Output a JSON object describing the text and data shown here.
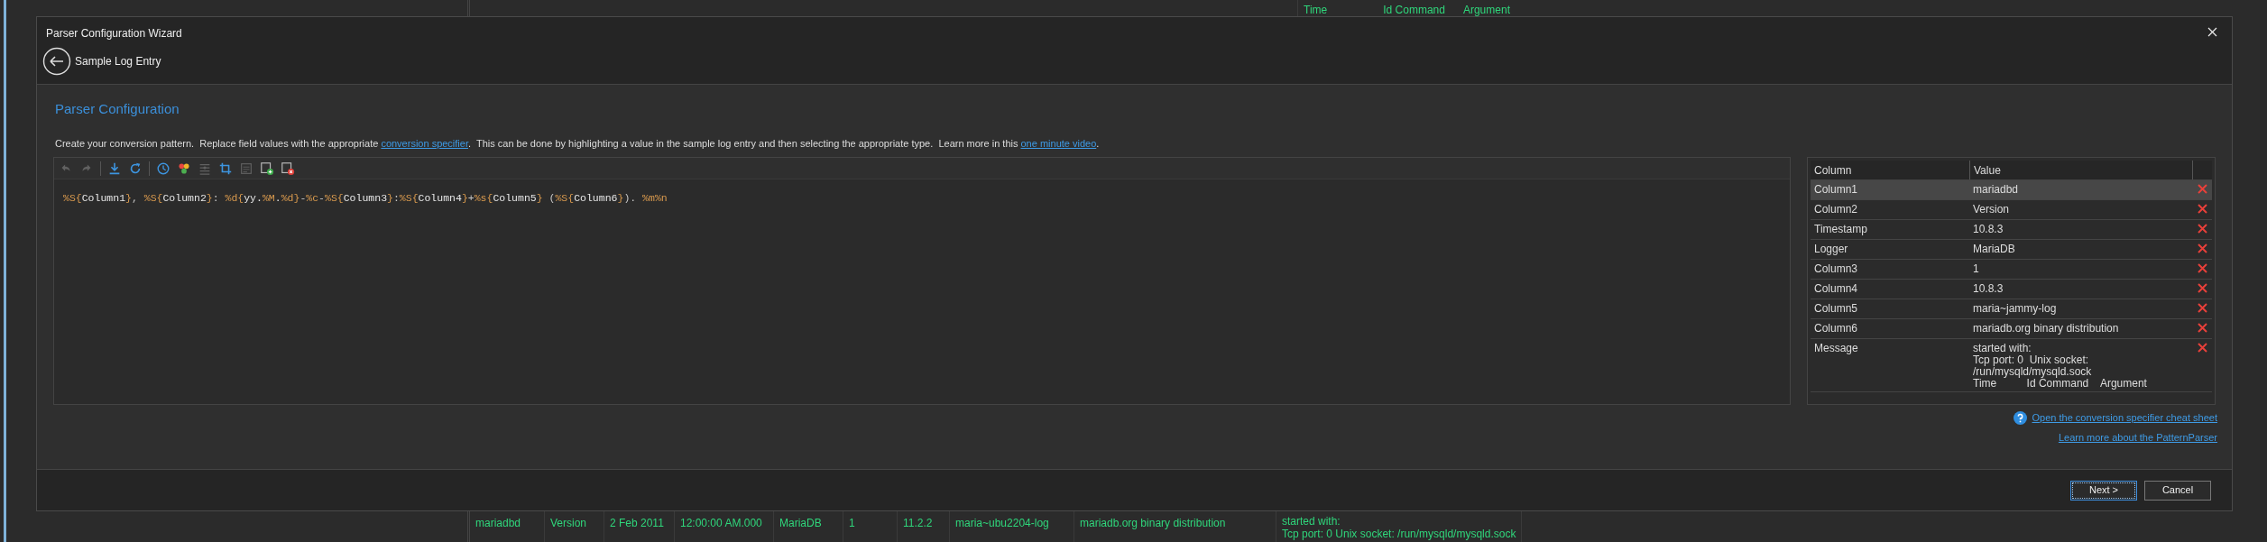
{
  "background_grid": {
    "partial_row": {
      "message_tail": [
        "Time",
        "Id Command",
        "Argument"
      ]
    },
    "row": {
      "cells": [
        "mariadbd",
        "Version",
        "2 Feb 2011",
        "12:00:00 AM.000",
        "MariaDB",
        "1",
        "11.2.2",
        "maria~ubu2204-log",
        "mariadb.org binary distribution"
      ],
      "message_lines": [
        "started with:",
        "Tcp port: 0  Unix socket: /run/mysqld/mysqld.sock"
      ]
    }
  },
  "dialog": {
    "title": "Parser Configuration Wizard",
    "back_step": "Sample Log Entry",
    "heading": "Parser Configuration",
    "instructions": [
      {
        "text": "Create your conversion pattern.  Replace field values with the appropriate ",
        "kind": "text"
      },
      {
        "text": "conversion specifier",
        "kind": "link"
      },
      {
        "text": ".  This can be done by highlighting a value in the sample log entry and then selecting the appropriate type.  Learn more in this ",
        "kind": "text"
      },
      {
        "text": "one minute video",
        "kind": "link"
      },
      {
        "text": ".",
        "kind": "text"
      }
    ],
    "toolbar": [
      {
        "kind": "undo",
        "disabled": true
      },
      {
        "kind": "redo",
        "disabled": true
      },
      {
        "kind": "separator"
      },
      {
        "kind": "download",
        "disabled": false
      },
      {
        "kind": "refresh",
        "disabled": false
      },
      {
        "kind": "separator"
      },
      {
        "kind": "clock",
        "disabled": false
      },
      {
        "kind": "colors",
        "disabled": false
      },
      {
        "kind": "list",
        "disabled": true
      },
      {
        "kind": "crop",
        "disabled": false
      },
      {
        "kind": "document",
        "disabled": true
      },
      {
        "kind": "add_document",
        "disabled": false
      },
      {
        "kind": "remove_document",
        "disabled": false
      }
    ],
    "pattern": [
      {
        "text": "%S{",
        "kind": "spec"
      },
      {
        "text": "Column1",
        "kind": "field"
      },
      {
        "text": "}",
        "kind": "spec"
      },
      {
        "text": ", ",
        "kind": "literal"
      },
      {
        "text": "%S{",
        "kind": "spec"
      },
      {
        "text": "Column2",
        "kind": "field"
      },
      {
        "text": "}",
        "kind": "spec"
      },
      {
        "text": ": ",
        "kind": "literal"
      },
      {
        "text": "%d{",
        "kind": "spec"
      },
      {
        "text": "yy.",
        "kind": "field"
      },
      {
        "text": "%M",
        "kind": "spec"
      },
      {
        "text": ".",
        "kind": "field"
      },
      {
        "text": "%d",
        "kind": "spec"
      },
      {
        "text": "}",
        "kind": "spec"
      },
      {
        "text": "-",
        "kind": "literal"
      },
      {
        "text": "%c",
        "kind": "spec"
      },
      {
        "text": "-",
        "kind": "literal"
      },
      {
        "text": "%S{",
        "kind": "spec"
      },
      {
        "text": "Column3",
        "kind": "field"
      },
      {
        "text": "}",
        "kind": "spec"
      },
      {
        "text": ":",
        "kind": "literal"
      },
      {
        "text": "%S{",
        "kind": "spec"
      },
      {
        "text": "Column4",
        "kind": "field"
      },
      {
        "text": "}",
        "kind": "spec"
      },
      {
        "text": "+",
        "kind": "literal"
      },
      {
        "text": "%s{",
        "kind": "spec"
      },
      {
        "text": "Column5",
        "kind": "field"
      },
      {
        "text": "}",
        "kind": "spec"
      },
      {
        "text": " (",
        "kind": "literal"
      },
      {
        "text": "%S{",
        "kind": "spec"
      },
      {
        "text": "Column6",
        "kind": "field"
      },
      {
        "text": "}",
        "kind": "spec"
      },
      {
        "text": "). ",
        "kind": "literal"
      },
      {
        "text": "%m%n",
        "kind": "spec"
      }
    ],
    "table": {
      "columns": [
        "Column",
        "Value"
      ],
      "rows": [
        {
          "column": "Column1",
          "value": [
            "mariadbd"
          ],
          "selected": true
        },
        {
          "column": "Column2",
          "value": [
            "Version"
          ],
          "selected": false
        },
        {
          "column": "Timestamp",
          "value": [
            "10.8.3"
          ],
          "selected": false
        },
        {
          "column": "Logger",
          "value": [
            "MariaDB"
          ],
          "selected": false
        },
        {
          "column": "Column3",
          "value": [
            "1"
          ],
          "selected": false
        },
        {
          "column": "Column4",
          "value": [
            "10.8.3"
          ],
          "selected": false
        },
        {
          "column": "Column5",
          "value": [
            "maria~jammy-log"
          ],
          "selected": false
        },
        {
          "column": "Column6",
          "value": [
            "mariadb.org binary distribution"
          ],
          "selected": false
        },
        {
          "column": "Message",
          "value": [
            "started with:",
            "Tcp port: 0  Unix socket:",
            "/run/mysqld/mysqld.sock",
            "Time          Id Command    Argument"
          ],
          "selected": false
        }
      ]
    },
    "links": [
      {
        "text": "Open the conversion specifier cheat sheet",
        "help_icon": true
      },
      {
        "text": "Learn more about the PatternParser",
        "help_icon": false
      }
    ],
    "buttons": [
      {
        "label": "Next >",
        "default": true
      },
      {
        "label": "Cancel",
        "default": false
      }
    ]
  }
}
